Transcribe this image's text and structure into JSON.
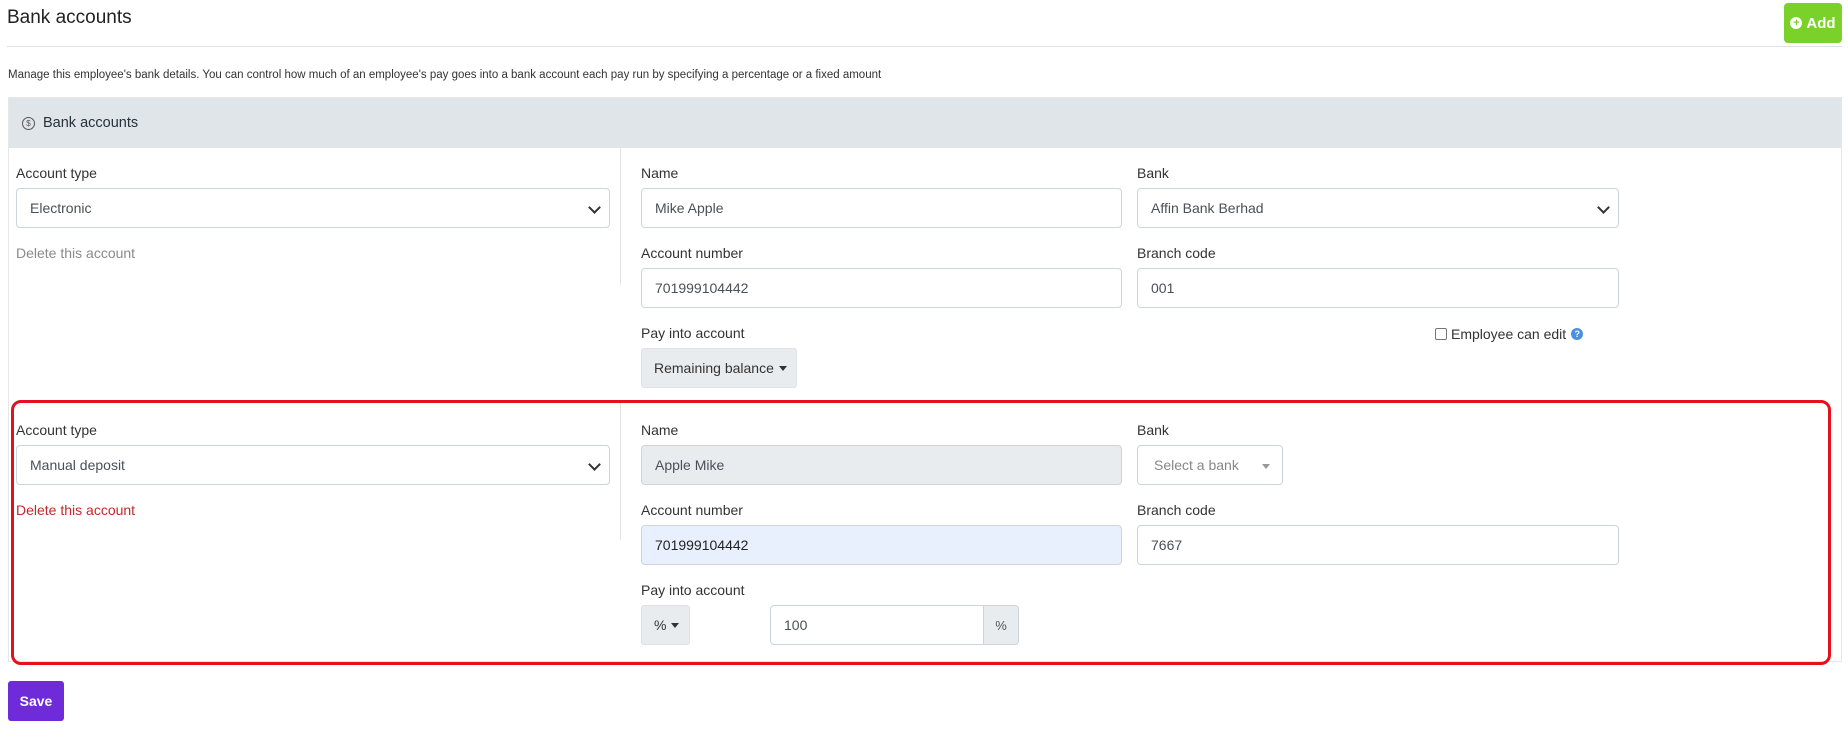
{
  "page": {
    "title": "Bank accounts",
    "add_label": "Add",
    "description": "Manage this employee's bank details. You can control how much of an employee's pay goes into a bank account each pay run by specifying a percentage or a fixed amount"
  },
  "panel": {
    "header": "Bank accounts"
  },
  "labels": {
    "account_type": "Account type",
    "name": "Name",
    "bank": "Bank",
    "account_number": "Account number",
    "branch_code": "Branch code",
    "pay_into_account": "Pay into account",
    "delete_account": "Delete this account",
    "employee_can_edit": "Employee can edit"
  },
  "accounts": [
    {
      "account_type": "Electronic",
      "name": "Mike Apple",
      "bank": "Affin Bank Berhad",
      "account_number": "701999104442",
      "branch_code": "001",
      "pay_into": "Remaining balance",
      "employee_can_edit": false
    },
    {
      "account_type": "Manual deposit",
      "name": "Apple Mike",
      "bank_placeholder": "Select a bank",
      "account_number": "701999104442",
      "branch_code": "7667",
      "pay_into": "%",
      "amount": "100",
      "amount_suffix": "%"
    }
  ],
  "save_label": "Save",
  "colors": {
    "add_button": "#7ad12a",
    "save_button": "#6f2bd9",
    "panel_header": "#dfe5e8",
    "delete_active": "#c62828",
    "highlight_outline": "#e5101d"
  },
  "icons": {
    "add": "plus-circle-icon",
    "panel": "dollar-circle-icon",
    "help": "question-circle-icon"
  }
}
